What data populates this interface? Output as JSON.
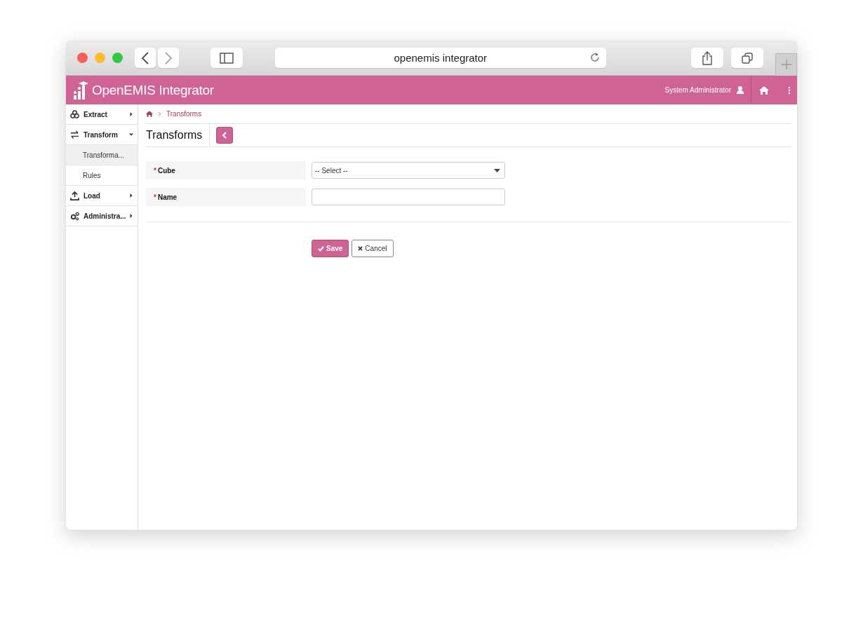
{
  "browser": {
    "address": "openemis integrator"
  },
  "app": {
    "title": "OpenEMIS Integrator",
    "user": "System Administrator"
  },
  "sidebar": {
    "items": [
      {
        "label": "Extract",
        "expanded": false,
        "selected": false
      },
      {
        "label": "Transform",
        "expanded": true,
        "selected": false,
        "children": [
          {
            "label": "Transforma...",
            "selected": true
          },
          {
            "label": "Rules",
            "selected": false
          }
        ]
      },
      {
        "label": "Load",
        "expanded": false,
        "selected": false
      },
      {
        "label": "Administra...",
        "expanded": false,
        "selected": false
      }
    ]
  },
  "breadcrumb": [
    "Transforms"
  ],
  "page_title": "Transforms",
  "form": {
    "fields": [
      {
        "kind": "select",
        "label": "Cube",
        "required_mark": "*",
        "value": "-- Select --"
      },
      {
        "kind": "text",
        "label": "Name",
        "required_mark": "*"
      }
    ]
  },
  "buttons": [
    {
      "kind": "primary",
      "label": "Save"
    },
    {
      "kind": "secondary",
      "label": "Cancel"
    }
  ]
}
